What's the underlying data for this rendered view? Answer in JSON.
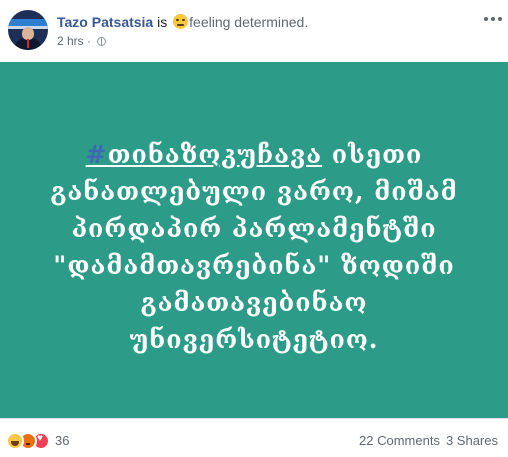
{
  "post": {
    "author": "Tazo Patsatsia",
    "is_text": "is",
    "feeling_icon": "determined-face-emoji",
    "feeling_text": "feeling determined.",
    "time": "2 hrs",
    "separator": "·",
    "privacy_icon": "globe-icon"
  },
  "image": {
    "background_color": "#2c9c88",
    "hash_symbol": "#",
    "hashtag_word": "თინაზოკუჩავა",
    "line1_rest": " ისეთი",
    "lines": [
      "განათლებული ვარო, მიშამ",
      "პირდაპირ პარლამენტში",
      "\"დამამთავრებინა\" ზოდიში",
      "გამათავებინაო",
      "უნივერსიტეტიო."
    ]
  },
  "footer": {
    "reaction_icons": [
      "haha-reaction-icon",
      "angry-reaction-icon",
      "love-reaction-icon"
    ],
    "reaction_count": "36",
    "comments": "22 Comments",
    "shares": "3 Shares"
  }
}
